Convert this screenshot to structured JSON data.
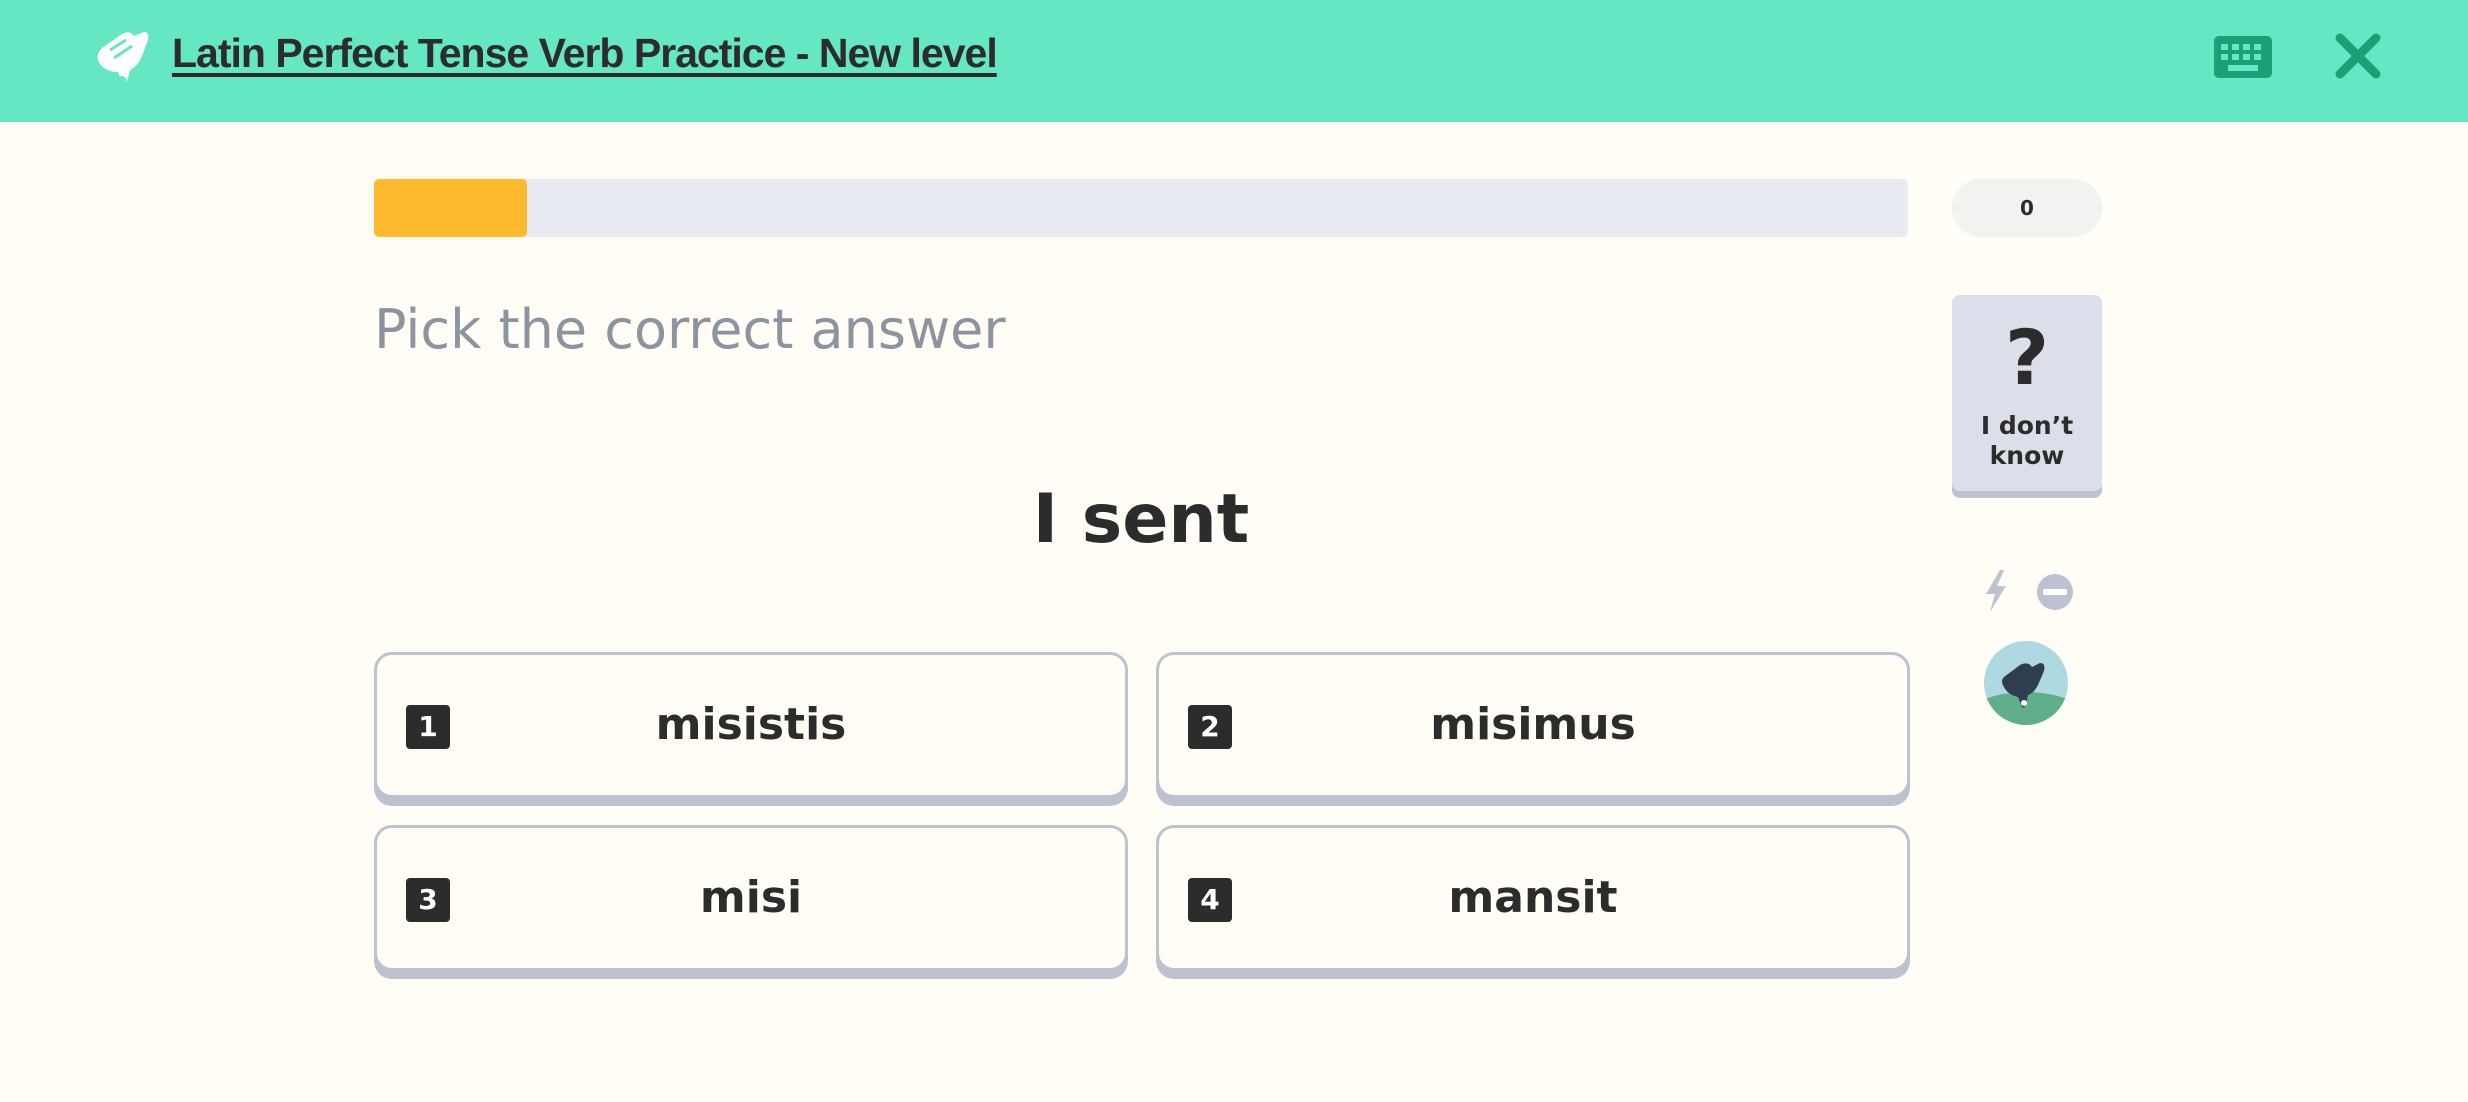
{
  "header": {
    "title": "Latin Perfect Tense Verb Practice - New level",
    "background_color": "#64e7c2",
    "logo_icon": "hand-icon",
    "keyboard_icon": "keyboard-icon",
    "close_icon": "close-icon"
  },
  "progress": {
    "fraction": 0.1,
    "fill_color": "#ffb92e",
    "score": "0"
  },
  "prompt": "Pick the correct answer",
  "question": "I sent",
  "choices": [
    {
      "number": "1",
      "text": "misistis"
    },
    {
      "number": "2",
      "text": "misimus"
    },
    {
      "number": "3",
      "text": "misi"
    },
    {
      "number": "4",
      "text": "mansit"
    }
  ],
  "sidebar": {
    "dont_know_icon": "question-mark-icon",
    "dont_know_label": "I don’t know",
    "speed_icon": "bolt-icon",
    "skip_icon": "no-entry-icon",
    "avatar_icon": "avatar"
  }
}
